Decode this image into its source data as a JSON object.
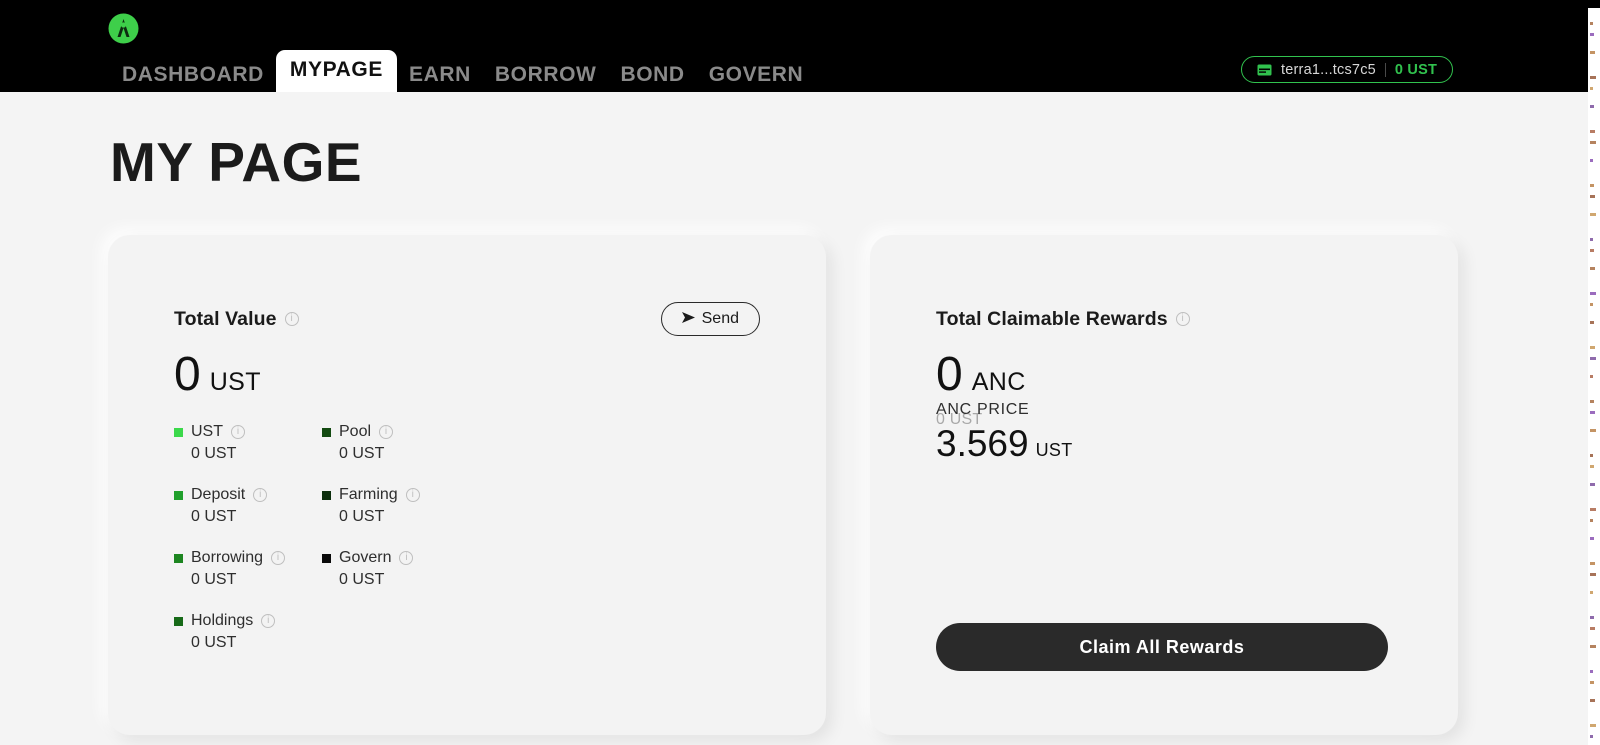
{
  "app": {
    "logo_name": "anchor-logo",
    "brand_color": "#31c24e"
  },
  "nav": {
    "items": [
      {
        "label": "DASHBOARD",
        "active": false
      },
      {
        "label": "MYPAGE",
        "active": true
      },
      {
        "label": "EARN",
        "active": false
      },
      {
        "label": "BORROW",
        "active": false
      },
      {
        "label": "BOND",
        "active": false
      },
      {
        "label": "GOVERN",
        "active": false
      }
    ]
  },
  "wallet": {
    "icon": "wallet-icon",
    "address": "terra1...tcs7c5",
    "balance": "0 UST",
    "border_color": "#31c24e"
  },
  "page": {
    "title": "MY PAGE"
  },
  "total_value_card": {
    "title": "Total Value",
    "info_icon": "info-icon",
    "send_button": "Send",
    "send_icon": "send-icon",
    "amount": "0",
    "unit": "UST",
    "breakdown": [
      {
        "label": "UST",
        "value": "0 UST",
        "color": "#3bd84a"
      },
      {
        "label": "Pool",
        "value": "0 UST",
        "color": "#134a11"
      },
      {
        "label": "Deposit",
        "value": "0 UST",
        "color": "#21a02c"
      },
      {
        "label": "Farming",
        "value": "0 UST",
        "color": "#0c2e0c"
      },
      {
        "label": "Borrowing",
        "value": "0 UST",
        "color": "#1c8520"
      },
      {
        "label": "Govern",
        "value": "0 UST",
        "color": "#0a0a0a"
      },
      {
        "label": "Holdings",
        "value": "0 UST",
        "color": "#176a18"
      }
    ]
  },
  "rewards_card": {
    "title": "Total Claimable Rewards",
    "info_icon": "info-icon",
    "amount": "0",
    "unit": "ANC",
    "sub_amount": "0 UST",
    "price_label": "ANC PRICE",
    "price_value": "3.569",
    "price_unit": "UST",
    "claim_button": "Claim All Rewards"
  }
}
